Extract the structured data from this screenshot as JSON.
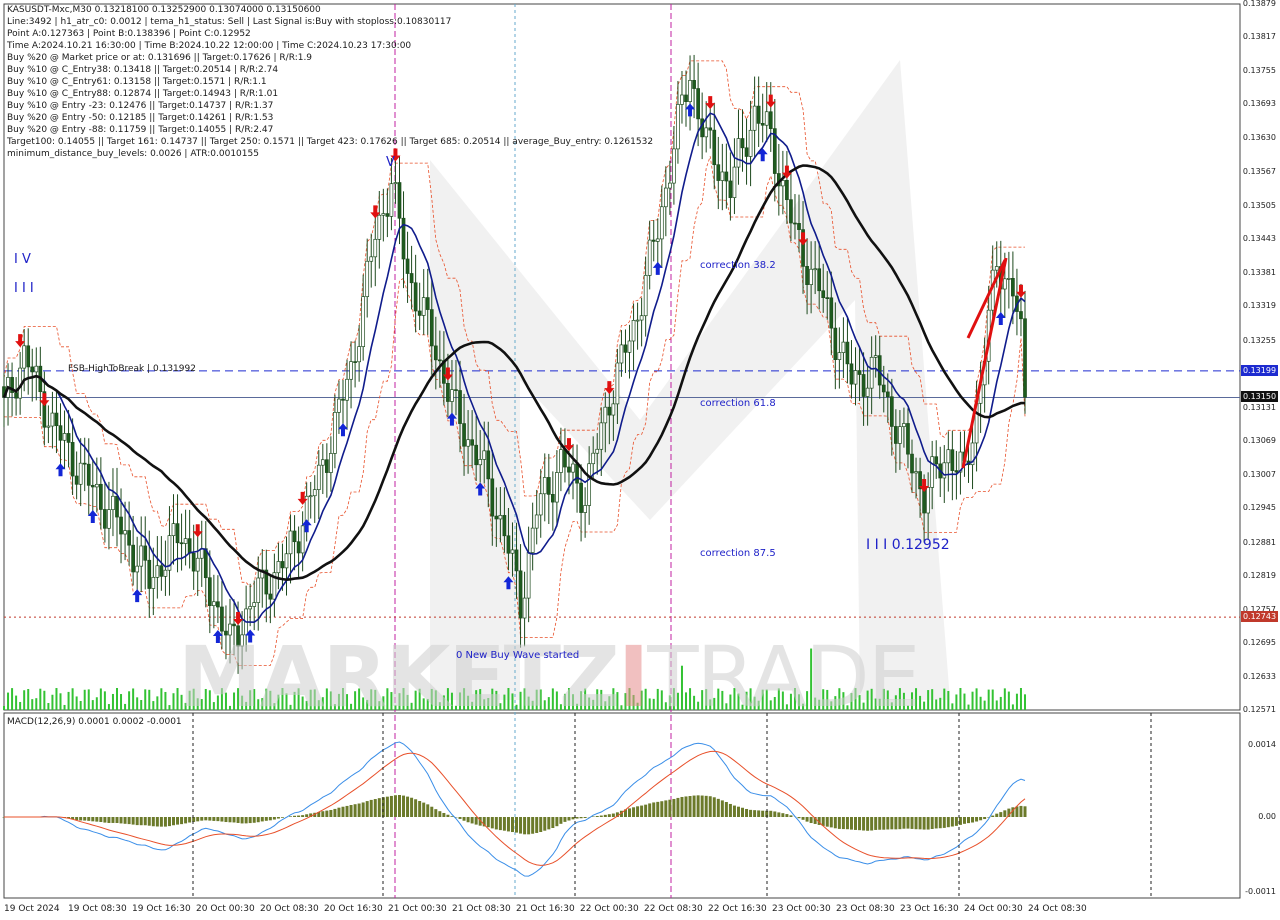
{
  "header_lines": [
    "KASUSDT-Mxc,M30  0.13218100 0.13252900 0.13074000 0.13150600",
    "Line:3492  | h1_atr_c0: 0.0012  | tema_h1_status: Sell  | Last Signal is:Buy with stoploss:0.10830117",
    "Point A:0.127363  | Point B:0.138396  | Point C:0.12952",
    "Time A:2024.10.21 16:30:00  | Time B:2024.10.22 12:00:00  | Time C:2024.10.23 17:30:00",
    "Buy %20 @ Market price or at: 0.131696  || Target:0.17626  | R/R:1.9",
    "Buy %10 @ C_Entry38: 0.13418  || Target:0.20514  | R/R:2.74",
    "Buy %10 @ C_Entry61: 0.13158  || Target:0.1571  | R/R:1.1",
    "Buy %10 @ C_Entry88: 0.12874  || Target:0.14943  | R/R:1.01",
    "Buy %10 @ Entry -23: 0.12476  || Target:0.14737  | R/R:1.37",
    "Buy %20 @ Entry -50: 0.12185  || Target:0.14261  | R/R:1.53",
    "Buy %20 @ Entry -88: 0.11759  || Target:0.14055  | R/R:2.47",
    "Target100: 0.14055  || Target 161: 0.14737  || Target 250: 0.1571  || Target 423: 0.17626  || Target 685: 0.20514  || average_Buy_entry: 0.1261532",
    "minimum_distance_buy_levels: 0.0026  | ATR:0.0010155"
  ],
  "annotations": {
    "wave_iv": "I V",
    "wave_iii": "I I I",
    "wave_v": "V",
    "fsb": "FSB-HighToBreak  | 0.131992",
    "corr38": "correction 38.2",
    "corr61": "correction 61.8",
    "corr87": "correction 87.5",
    "new_wave": "0 New Buy Wave started",
    "point_c": "I I I 0.12952"
  },
  "watermark": {
    "part1": "MARKETZ",
    "part2": "I",
    "part3": "TRADE"
  },
  "macd_label": "MACD(12,26,9) 0.0001 0.0002 -0.0001",
  "colors": {
    "bull": "#1e5c1e",
    "bear": "#1e5c1e",
    "ma_slow": "#111111",
    "ma_fast": "#101c8c",
    "envelope": "#e8502a",
    "hline_blue": "#1d2bd0",
    "hline_red": "#c0392b",
    "buy_arrow": "#1326d6",
    "sell_arrow": "#e01010",
    "macd_hist": "#6b7a2a",
    "macd_main": "#3a8ee8",
    "macd_signal": "#e8502a",
    "volume": "#33c233"
  },
  "chart_data": {
    "type": "candlestick",
    "symbol": "KASUSDT-Mxc",
    "timeframe": "M30",
    "ohlc_last": {
      "open": 0.132181,
      "high": 0.132529,
      "low": 0.13074,
      "close": 0.131506
    },
    "ylim": [
      0.12571,
      0.13879
    ],
    "price_ticks": [
      "0.13879",
      "0.13817",
      "0.13755",
      "0.13693",
      "0.13630",
      "0.13567",
      "0.13505",
      "0.13443",
      "0.13381",
      "0.13319",
      "0.13255",
      "0.13193",
      "0.13131",
      "0.13069",
      "0.13007",
      "0.12945",
      "0.12881",
      "0.12819",
      "0.12757",
      "0.12695",
      "0.12633",
      "0.12571"
    ],
    "price_badges": [
      {
        "label": "0.13199",
        "value": 0.13199,
        "color": "#1d2bd0"
      },
      {
        "label": "0.13150",
        "value": 0.1315,
        "color": "#111111"
      },
      {
        "label": "0.12743",
        "value": 0.12743,
        "color": "#c0392b"
      }
    ],
    "hlines": [
      {
        "value": 0.131992,
        "style": "dashed",
        "color": "#1d2bd0"
      },
      {
        "value": 0.1315,
        "style": "solid",
        "color": "#5a6a9a"
      },
      {
        "value": 0.12743,
        "style": "dotted",
        "color": "#c0392b"
      }
    ],
    "time_labels": [
      "19 Oct 2024",
      "19 Oct 08:30",
      "19 Oct 16:30",
      "20 Oct 00:30",
      "20 Oct 08:30",
      "20 Oct 16:30",
      "21 Oct 00:30",
      "21 Oct 08:30",
      "21 Oct 16:30",
      "22 Oct 00:30",
      "22 Oct 08:30",
      "22 Oct 16:30",
      "23 Oct 00:30",
      "23 Oct 08:30",
      "23 Oct 16:30",
      "24 Oct 00:30",
      "24 Oct 08:30"
    ],
    "close_keypoints": [
      [
        0,
        0.1313
      ],
      [
        5,
        0.1323
      ],
      [
        12,
        0.131
      ],
      [
        20,
        0.13
      ],
      [
        28,
        0.1292
      ],
      [
        36,
        0.1281
      ],
      [
        44,
        0.129
      ],
      [
        52,
        0.1278
      ],
      [
        56,
        0.1269
      ],
      [
        62,
        0.1278
      ],
      [
        70,
        0.1285
      ],
      [
        78,
        0.13
      ],
      [
        86,
        0.132
      ],
      [
        92,
        0.1345
      ],
      [
        96,
        0.1355
      ],
      [
        100,
        0.1338
      ],
      [
        106,
        0.1326
      ],
      [
        112,
        0.1312
      ],
      [
        118,
        0.1303
      ],
      [
        124,
        0.129
      ],
      [
        128,
        0.1277
      ],
      [
        132,
        0.1294
      ],
      [
        138,
        0.1303
      ],
      [
        144,
        0.1297
      ],
      [
        150,
        0.1315
      ],
      [
        156,
        0.1328
      ],
      [
        162,
        0.1346
      ],
      [
        166,
        0.1362
      ],
      [
        170,
        0.1375
      ],
      [
        174,
        0.1362
      ],
      [
        180,
        0.1354
      ],
      [
        186,
        0.1368
      ],
      [
        190,
        0.1363
      ],
      [
        196,
        0.1345
      ],
      [
        202,
        0.1335
      ],
      [
        210,
        0.1318
      ],
      [
        216,
        0.132
      ],
      [
        222,
        0.1308
      ],
      [
        228,
        0.1297
      ],
      [
        234,
        0.1305
      ],
      [
        238,
        0.13
      ],
      [
        242,
        0.1318
      ],
      [
        246,
        0.134
      ],
      [
        250,
        0.1335
      ],
      [
        253,
        0.1321
      ]
    ],
    "envelope_offset": 0.0009,
    "ma_fast_period": 10,
    "ma_slow_period": 40,
    "buy_signals": [
      14,
      22,
      33,
      53,
      61,
      75,
      84,
      111,
      118,
      125,
      162,
      170,
      188,
      247
    ],
    "sell_signals": [
      4,
      10,
      48,
      58,
      74,
      92,
      97,
      110,
      140,
      150,
      175,
      190,
      194,
      198,
      228,
      252
    ],
    "macd": {
      "ylim": [
        -0.0001,
        0.0014
      ],
      "ticks": [
        "0.0014",
        "0.00",
        "-0.0011"
      ]
    }
  }
}
